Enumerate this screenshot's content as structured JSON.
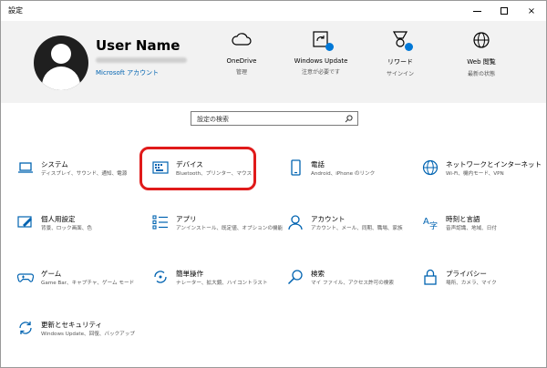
{
  "window": {
    "title": "設定",
    "minimize": "minimize",
    "maximize": "maximize",
    "close": "×"
  },
  "account": {
    "name": "User Name",
    "link": "Microsoft アカウント"
  },
  "quick_actions": [
    {
      "label": "OneDrive",
      "sub": "管理",
      "icon": "cloud-icon"
    },
    {
      "label": "Windows Update",
      "sub": "注意が必要です",
      "icon": "update-icon"
    },
    {
      "label": "リワード",
      "sub": "サインイン",
      "icon": "rewards-icon"
    },
    {
      "label": "Web 閲覧",
      "sub": "最新の状態",
      "icon": "globe-icon"
    }
  ],
  "search": {
    "placeholder": "設定の検索"
  },
  "categories": [
    {
      "name": "システム",
      "desc": "ディスプレイ、サウンド、通知、電源",
      "icon": "laptop-icon"
    },
    {
      "name": "デバイス",
      "desc": "Bluetooth、プリンター、マウス",
      "icon": "keyboard-icon"
    },
    {
      "name": "電話",
      "desc": "Android、iPhone のリンク",
      "icon": "phone-icon"
    },
    {
      "name": "ネットワークとインターネット",
      "desc": "Wi-Fi、機内モード、VPN",
      "icon": "globe-icon"
    },
    {
      "name": "個人用設定",
      "desc": "背景、ロック画面、色",
      "icon": "personalization-icon"
    },
    {
      "name": "アプリ",
      "desc": "アンインストール、既定値、オプションの機能",
      "icon": "apps-icon"
    },
    {
      "name": "アカウント",
      "desc": "アカウント、メール、同期、職場、家族",
      "icon": "person-icon"
    },
    {
      "name": "時刻と言語",
      "desc": "音声認識、地域、日付",
      "icon": "time-language-icon"
    },
    {
      "name": "ゲーム",
      "desc": "Game Bar、キャプチャ、ゲーム モード",
      "icon": "gamepad-icon"
    },
    {
      "name": "簡単操作",
      "desc": "ナレーター、拡大鏡、ハイコントラスト",
      "icon": "ease-of-access-icon"
    },
    {
      "name": "検索",
      "desc": "マイ ファイル、アクセス許可の検索",
      "icon": "search-icon"
    },
    {
      "name": "プライバシー",
      "desc": "場所、カメラ、マイク",
      "icon": "lock-icon"
    },
    {
      "name": "更新とセキュリティ",
      "desc": "Windows Update、回復、バックアップ",
      "icon": "sync-icon"
    }
  ],
  "colors": {
    "accent": "#0078d7",
    "link": "#0063b1",
    "highlight": "#e01a1a",
    "header_bg": "#f2f2f2"
  }
}
